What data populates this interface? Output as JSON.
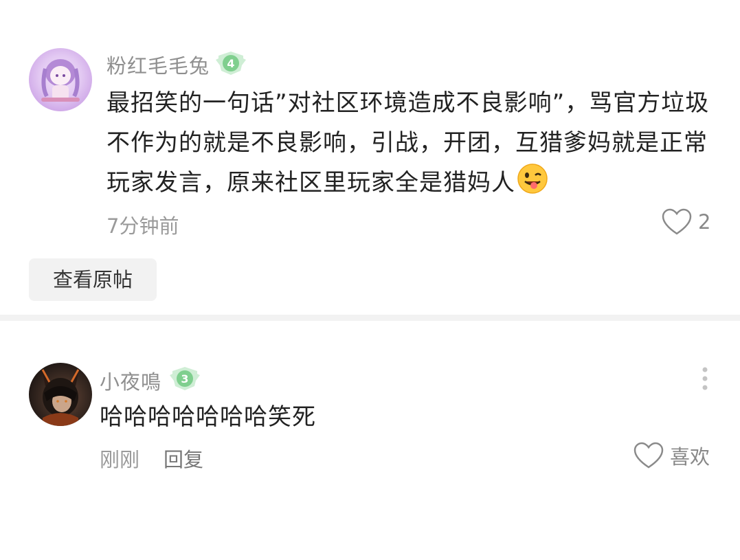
{
  "quoted_comment": {
    "username": "粉红毛毛兔",
    "level": "4",
    "text": "最招笑的一句话”对社区环境造成不良影响”，骂官方垃圾不作为的就是不良影响，引战，开团，互猎爹妈就是正常玩家发言，原来社区里玩家全是猎妈人",
    "emoji": "winking-face-with-tongue",
    "time": "7分钟前",
    "likes": "2",
    "view_original_label": "查看原帖"
  },
  "reply_comment": {
    "username": "小夜鳴",
    "level": "3",
    "text": "哈哈哈哈哈哈哈笑死",
    "time": "刚刚",
    "reply_label": "回复",
    "like_label": "喜欢"
  },
  "colors": {
    "badge_green": "#8fd39a",
    "badge_green_dark": "#5cb86e",
    "divider": "#f2f2f2"
  }
}
